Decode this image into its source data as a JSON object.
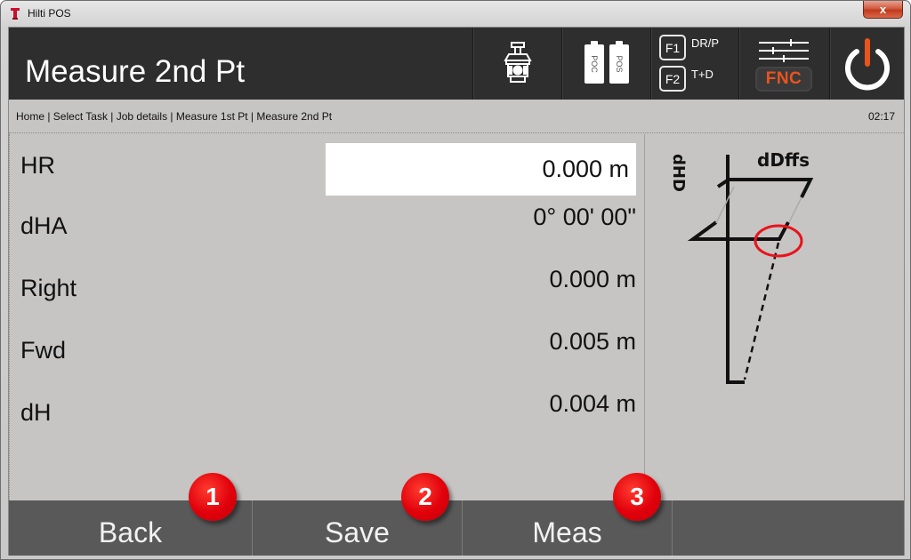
{
  "window": {
    "title": "Hilti POS",
    "close_label": "x"
  },
  "header": {
    "page_title": "Measure 2nd Pt",
    "status_icons": {
      "instrument": "total-station-icon",
      "batteries": [
        "POC",
        "POS"
      ]
    },
    "function_keys": [
      {
        "key": "F1",
        "label": "DR/P"
      },
      {
        "key": "F2",
        "label": "T+D"
      }
    ],
    "fnc_label": "FNC",
    "power_icon": "power-icon"
  },
  "breadcrumb": {
    "path": "Home | Select Task | Job details | Measure 1st Pt | Measure 2nd Pt",
    "time": "02:17"
  },
  "fields": [
    {
      "label": "HR",
      "value": "0.000 m",
      "editable": true
    },
    {
      "label": "dHA",
      "value": "0° 00' 00\""
    },
    {
      "label": "Right",
      "value": "0.000 m"
    },
    {
      "label": "Fwd",
      "value": "0.005 m"
    },
    {
      "label": "dH",
      "value": "0.004 m"
    }
  ],
  "diagram": {
    "label_vertical": "dHD",
    "label_horizontal": "dDffs",
    "highlight_color": "#e8141c"
  },
  "footer": {
    "buttons": [
      "Back",
      "Save",
      "Meas",
      ""
    ]
  },
  "callouts": [
    "1",
    "2",
    "3"
  ],
  "colors": {
    "header_bg": "#2e2e2e",
    "accent_orange": "#e8541e",
    "footer_bg": "#595959",
    "content_bg": "#c6c5c3"
  }
}
